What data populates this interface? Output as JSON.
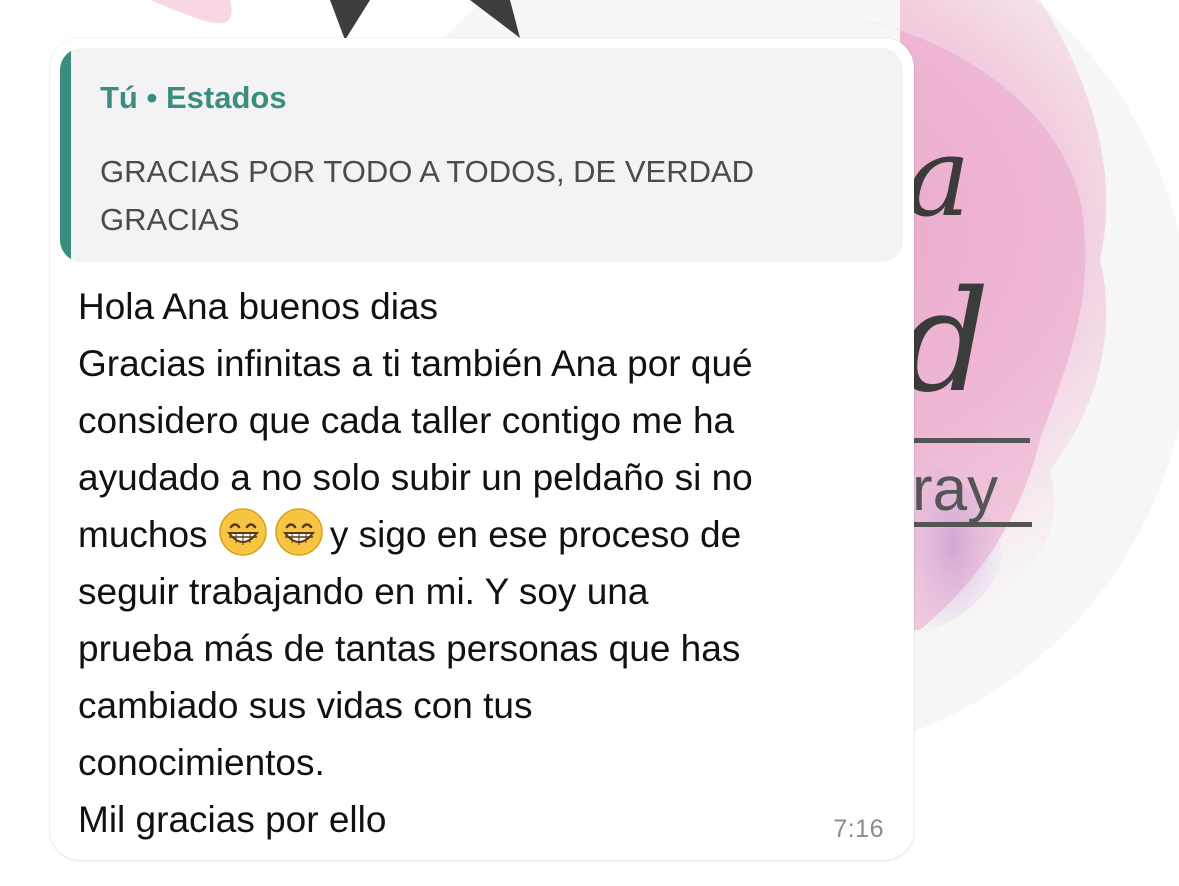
{
  "background": {
    "logo_letters": [
      "a",
      "d",
      "ray"
    ]
  },
  "quote": {
    "author": "Tú",
    "separator": "•",
    "source": "Estados",
    "text_lines": [
      "GRACIAS POR TODO A TODOS, DE VERDAD",
      "GRACIAS"
    ]
  },
  "message": {
    "lines": {
      "l1": "Hola Ana buenos dias",
      "l2": "Gracias infinitas a ti también Ana por qué",
      "l3": "considero que cada taller contigo me ha",
      "l4": "ayudado a no solo subir un peldaño si no",
      "l5_start": "muchos ",
      "l5_end": "y sigo en ese proceso de",
      "l6": "seguir trabajando en mi. Y soy una",
      "l7": "prueba más de tantas personas que has",
      "l8": "cambiado sus vidas con tus",
      "l9": "conocimientos.",
      "l10": "Mil gracias por ello"
    },
    "emoji": [
      "grinning-face-with-smiling-eyes",
      "grinning-face-with-smiling-eyes"
    ],
    "time": "7:16"
  },
  "colors": {
    "accent": "#3b8d7f",
    "quote_bg": "#f3f2f4",
    "bg_pink": "#e9a3c4",
    "bg_purple": "#c9a6d8",
    "time": "#8b8b8e"
  }
}
